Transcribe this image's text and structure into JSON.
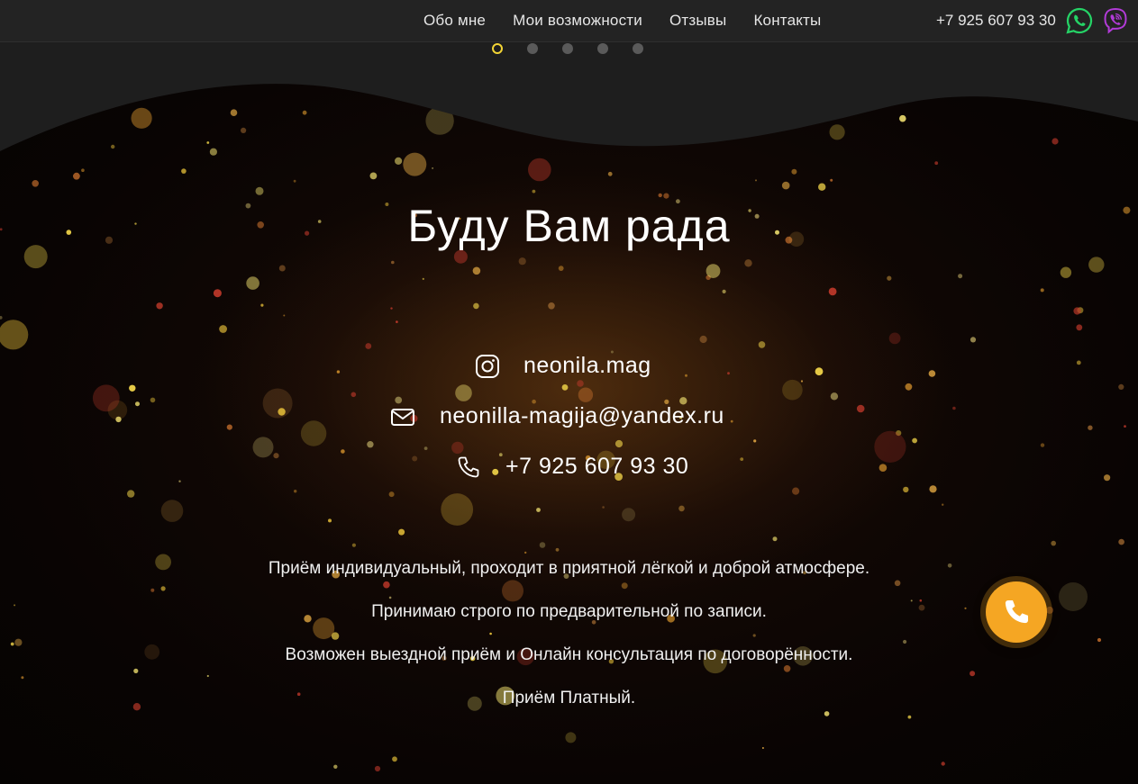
{
  "header": {
    "nav": [
      {
        "label": "Обо мне"
      },
      {
        "label": "Мои возможности"
      },
      {
        "label": "Отзывы"
      },
      {
        "label": "Контакты"
      }
    ],
    "phone": "+7 925 607 93 30",
    "messengers": [
      {
        "icon": "whatsapp-icon",
        "color": "#25d366"
      },
      {
        "icon": "viber-icon",
        "color": "#b23bd8"
      }
    ]
  },
  "slider": {
    "dots_count": 5,
    "active_index": 0,
    "active_color": "#f2d435"
  },
  "contacts": {
    "title": "Буду Вам рада",
    "items": [
      {
        "icon": "instagram-icon",
        "text": "neonila.mag"
      },
      {
        "icon": "mail-icon",
        "text": "neonilla-magija@yandex.ru"
      },
      {
        "icon": "phone-icon",
        "text": "+7 925 607 93 30"
      }
    ],
    "info": [
      "Приём индивидуальный, проходит в приятной лёгкой и доброй атмосфере.",
      "Принимаю строго по предварительной по записи.",
      "Возможен выездной приём и Онлайн консультация по договорённости.",
      "Приём Платный."
    ]
  },
  "call_button": {
    "icon": "phone-icon",
    "color": "#f5a623"
  },
  "colors": {
    "accent": "#f5a623",
    "background": "#0b0604",
    "header": "#232323"
  }
}
